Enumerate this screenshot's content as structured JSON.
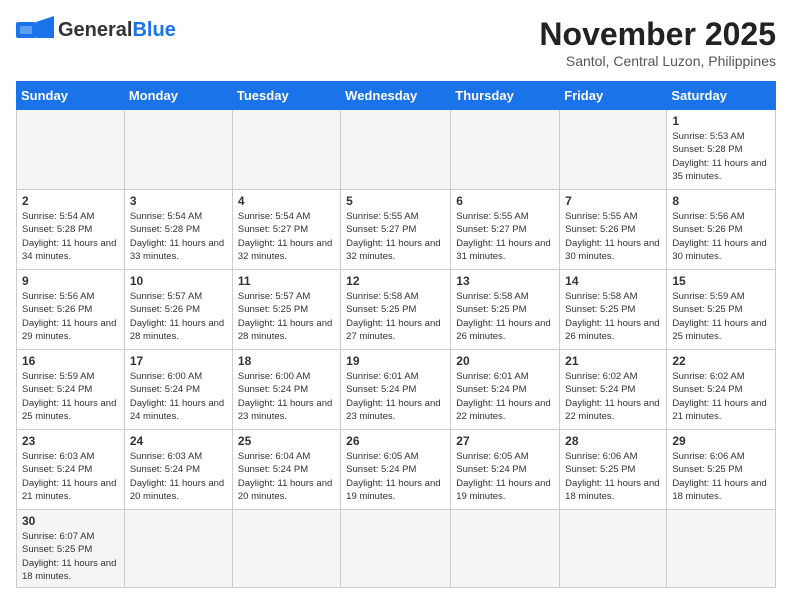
{
  "header": {
    "logo_general": "General",
    "logo_blue": "Blue",
    "month_title": "November 2025",
    "location": "Santol, Central Luzon, Philippines"
  },
  "weekdays": [
    "Sunday",
    "Monday",
    "Tuesday",
    "Wednesday",
    "Thursday",
    "Friday",
    "Saturday"
  ],
  "days": {
    "d1": {
      "num": "1",
      "sunrise": "5:53 AM",
      "sunset": "5:28 PM",
      "daylight": "11 hours and 35 minutes."
    },
    "d2": {
      "num": "2",
      "sunrise": "5:54 AM",
      "sunset": "5:28 PM",
      "daylight": "11 hours and 34 minutes."
    },
    "d3": {
      "num": "3",
      "sunrise": "5:54 AM",
      "sunset": "5:28 PM",
      "daylight": "11 hours and 33 minutes."
    },
    "d4": {
      "num": "4",
      "sunrise": "5:54 AM",
      "sunset": "5:27 PM",
      "daylight": "11 hours and 32 minutes."
    },
    "d5": {
      "num": "5",
      "sunrise": "5:55 AM",
      "sunset": "5:27 PM",
      "daylight": "11 hours and 32 minutes."
    },
    "d6": {
      "num": "6",
      "sunrise": "5:55 AM",
      "sunset": "5:27 PM",
      "daylight": "11 hours and 31 minutes."
    },
    "d7": {
      "num": "7",
      "sunrise": "5:55 AM",
      "sunset": "5:26 PM",
      "daylight": "11 hours and 30 minutes."
    },
    "d8": {
      "num": "8",
      "sunrise": "5:56 AM",
      "sunset": "5:26 PM",
      "daylight": "11 hours and 30 minutes."
    },
    "d9": {
      "num": "9",
      "sunrise": "5:56 AM",
      "sunset": "5:26 PM",
      "daylight": "11 hours and 29 minutes."
    },
    "d10": {
      "num": "10",
      "sunrise": "5:57 AM",
      "sunset": "5:26 PM",
      "daylight": "11 hours and 28 minutes."
    },
    "d11": {
      "num": "11",
      "sunrise": "5:57 AM",
      "sunset": "5:25 PM",
      "daylight": "11 hours and 28 minutes."
    },
    "d12": {
      "num": "12",
      "sunrise": "5:58 AM",
      "sunset": "5:25 PM",
      "daylight": "11 hours and 27 minutes."
    },
    "d13": {
      "num": "13",
      "sunrise": "5:58 AM",
      "sunset": "5:25 PM",
      "daylight": "11 hours and 26 minutes."
    },
    "d14": {
      "num": "14",
      "sunrise": "5:58 AM",
      "sunset": "5:25 PM",
      "daylight": "11 hours and 26 minutes."
    },
    "d15": {
      "num": "15",
      "sunrise": "5:59 AM",
      "sunset": "5:25 PM",
      "daylight": "11 hours and 25 minutes."
    },
    "d16": {
      "num": "16",
      "sunrise": "5:59 AM",
      "sunset": "5:24 PM",
      "daylight": "11 hours and 25 minutes."
    },
    "d17": {
      "num": "17",
      "sunrise": "6:00 AM",
      "sunset": "5:24 PM",
      "daylight": "11 hours and 24 minutes."
    },
    "d18": {
      "num": "18",
      "sunrise": "6:00 AM",
      "sunset": "5:24 PM",
      "daylight": "11 hours and 23 minutes."
    },
    "d19": {
      "num": "19",
      "sunrise": "6:01 AM",
      "sunset": "5:24 PM",
      "daylight": "11 hours and 23 minutes."
    },
    "d20": {
      "num": "20",
      "sunrise": "6:01 AM",
      "sunset": "5:24 PM",
      "daylight": "11 hours and 22 minutes."
    },
    "d21": {
      "num": "21",
      "sunrise": "6:02 AM",
      "sunset": "5:24 PM",
      "daylight": "11 hours and 22 minutes."
    },
    "d22": {
      "num": "22",
      "sunrise": "6:02 AM",
      "sunset": "5:24 PM",
      "daylight": "11 hours and 21 minutes."
    },
    "d23": {
      "num": "23",
      "sunrise": "6:03 AM",
      "sunset": "5:24 PM",
      "daylight": "11 hours and 21 minutes."
    },
    "d24": {
      "num": "24",
      "sunrise": "6:03 AM",
      "sunset": "5:24 PM",
      "daylight": "11 hours and 20 minutes."
    },
    "d25": {
      "num": "25",
      "sunrise": "6:04 AM",
      "sunset": "5:24 PM",
      "daylight": "11 hours and 20 minutes."
    },
    "d26": {
      "num": "26",
      "sunrise": "6:05 AM",
      "sunset": "5:24 PM",
      "daylight": "11 hours and 19 minutes."
    },
    "d27": {
      "num": "27",
      "sunrise": "6:05 AM",
      "sunset": "5:24 PM",
      "daylight": "11 hours and 19 minutes."
    },
    "d28": {
      "num": "28",
      "sunrise": "6:06 AM",
      "sunset": "5:25 PM",
      "daylight": "11 hours and 18 minutes."
    },
    "d29": {
      "num": "29",
      "sunrise": "6:06 AM",
      "sunset": "5:25 PM",
      "daylight": "11 hours and 18 minutes."
    },
    "d30": {
      "num": "30",
      "sunrise": "6:07 AM",
      "sunset": "5:25 PM",
      "daylight": "11 hours and 18 minutes."
    }
  }
}
